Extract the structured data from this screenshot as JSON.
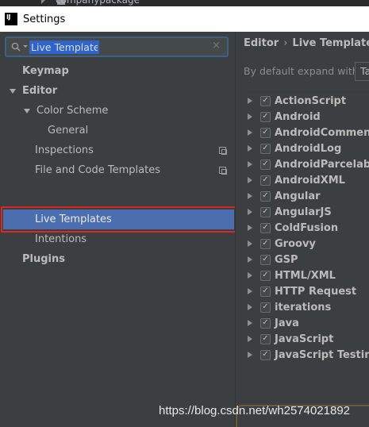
{
  "background_app": {
    "text": "companypackage"
  },
  "window": {
    "title": "Settings",
    "app_icon_text": "IJ"
  },
  "search": {
    "value": "Live Templates",
    "clear_glyph": "×"
  },
  "tree": {
    "keymap": "Keymap",
    "editor": "Editor",
    "color_scheme": "Color Scheme",
    "general": "General",
    "inspections": "Inspections",
    "file_code_templates": "File and Code Templates",
    "live_templates": "Live Templates",
    "intentions": "Intentions",
    "plugins": "Plugins"
  },
  "breadcrumb": {
    "parent": "Editor",
    "separator": "›",
    "current": "Live Templates"
  },
  "expand": {
    "label": "By default expand with",
    "value": "Tab"
  },
  "template_groups": [
    "ActionScript",
    "Android",
    "AndroidComments",
    "AndroidLog",
    "AndroidParcelable",
    "AndroidXML",
    "Angular",
    "AngularJS",
    "ColdFusion",
    "Groovy",
    "GSP",
    "HTML/XML",
    "HTTP Request",
    "iterations",
    "Java",
    "JavaScript",
    "JavaScript Testing"
  ],
  "checkbox_glyph": "✓",
  "watermark": "https://blog.csdn.net/wh2574021892",
  "colors": {
    "selection": "#4b6eaf",
    "highlight_border": "#e0261f",
    "search_selection": "#2f65ca"
  }
}
